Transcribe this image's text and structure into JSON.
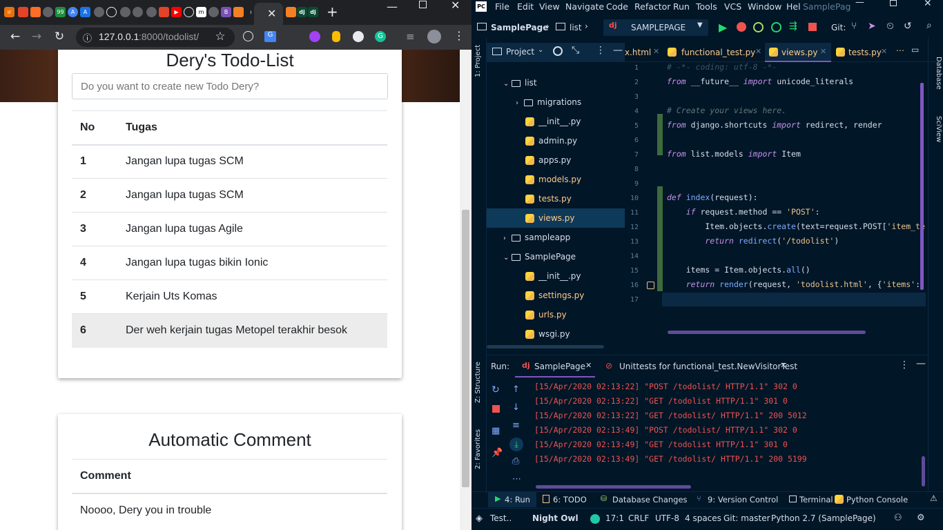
{
  "browser": {
    "url_host": "127.0.0.1",
    "url_rest": ":8000/todolist/"
  },
  "todo_card": {
    "title": "Dery's Todo-List",
    "input_placeholder": "Do you want to create new Todo Dery?",
    "headers": [
      "No",
      "Tugas"
    ],
    "rows": [
      {
        "no": "1",
        "task": "Jangan lupa tugas SCM"
      },
      {
        "no": "2",
        "task": "Jangan lupa tugas SCM"
      },
      {
        "no": "3",
        "task": "Jangan lupa tugas Agile"
      },
      {
        "no": "4",
        "task": "Jangan lupa tugas bikin Ionic"
      },
      {
        "no": "5",
        "task": "Kerjain Uts Komas"
      },
      {
        "no": "6",
        "task": "Der weh kerjain tugas Metopel terakhir besok"
      }
    ]
  },
  "comment_card": {
    "title": "Automatic Comment",
    "header": "Comment",
    "text": "Noooo, Dery you in trouble"
  },
  "ide": {
    "menu": [
      "File",
      "Edit",
      "View",
      "Navigate",
      "Code",
      "Refactor",
      "Run",
      "Tools",
      "VCS",
      "Window",
      "Hel"
    ],
    "window_title": "SamplePag",
    "breadcrumb_project": "SamplePage",
    "breadcrumb_folder": "list",
    "run_config": "SAMPLEPAGE",
    "git_label": "Git:",
    "project_label": "Project",
    "left_strip_project": "1: Project",
    "left_strip_structure": "Z: Structure",
    "left_strip_favorites": "2: Favorites",
    "right_strip_database": "Database",
    "right_strip_sciview": "SciView",
    "tree": {
      "list": "list",
      "migrations": "migrations",
      "init1": "__init__.py",
      "admin": "admin.py",
      "apps": "apps.py",
      "models": "models.py",
      "tests": "tests.py",
      "views": "views.py",
      "sampleapp": "sampleapp",
      "samplepage": "SamplePage",
      "init2": "__init__.py",
      "settings": "settings.py",
      "urls": "urls.py",
      "wsgi": "wsgi.py"
    },
    "editor_tabs": [
      "x.html",
      "functional_test.py",
      "views.py",
      "tests.py"
    ],
    "line_numbers": [
      "1",
      "2",
      "3",
      "4",
      "5",
      "6",
      "7",
      "8",
      "9",
      "10",
      "11",
      "12",
      "13",
      "14",
      "15",
      "16",
      "17"
    ],
    "code": {
      "l1": "# -*- coding: utf-8 -*-",
      "l2a": "from",
      "l2b": " __future__ ",
      "l2c": "import",
      "l2d": " unicode_literals",
      "l4": "# Create your views here.",
      "l5a": "from",
      "l5b": " django.shortcuts ",
      "l5c": "import",
      "l5d": " redirect, render",
      "l7a": "from",
      "l7b": " list.models ",
      "l7c": "import",
      "l7d": " Item",
      "l10a": "def",
      "l10b": " index",
      "l10c": "(request):",
      "l11a": "    if",
      "l11b": " request.method == ",
      "l11c": "'POST'",
      "l11d": ":",
      "l12a": "        Item.objects.",
      "l12b": "create",
      "l12c": "(text=request.POST[",
      "l12d": "'item_te",
      "l13a": "        return",
      "l13b": " redirect",
      "l13c": "(",
      "l13d": "'/todolist'",
      "l13e": ")",
      "l15a": "    items = Item.objects.",
      "l15b": "all",
      "l15c": "()",
      "l16a": "    return",
      "l16b": " render",
      "l16c": "(request, ",
      "l16d": "'todolist.html'",
      "l16e": ", {",
      "l16f": "'items'",
      "l16g": ":"
    },
    "run": {
      "label": "Run:",
      "tab1": "SamplePage",
      "tab2": "Unittests for functional_test.NewVisitorTest",
      "logs": [
        "[15/Apr/2020 02:13:22] \"POST /todolist/ HTTP/1.1\" 302 0",
        "[15/Apr/2020 02:13:22] \"GET /todolist HTTP/1.1\" 301 0",
        "[15/Apr/2020 02:13:22] \"GET /todolist/ HTTP/1.1\" 200 5012",
        "[15/Apr/2020 02:13:49] \"POST /todolist/ HTTP/1.1\" 302 0",
        "[15/Apr/2020 02:13:49] \"GET /todolist HTTP/1.1\" 301 0",
        "[15/Apr/2020 02:13:49] \"GET /todolist/ HTTP/1.1\" 200 5199"
      ]
    },
    "bottom_tabs": [
      "4: Run",
      "6: TODO",
      "Database Changes",
      "9: Version Control",
      "Terminal",
      "Python Console"
    ],
    "status": {
      "test": "Test..",
      "theme": "Night Owl",
      "position": "17:1",
      "line_sep": "CRLF",
      "encoding": "UTF-8",
      "indent": "4 spaces",
      "git": "Git: master",
      "interpreter": "Python 2.7 (SamplePage)"
    }
  },
  "colors": {
    "ide_bg": "#011627",
    "keyword": "#c792ea",
    "function": "#82aaff",
    "string": "#ecc48d",
    "log_red": "#ef5350",
    "browser_frame": "#202124"
  }
}
